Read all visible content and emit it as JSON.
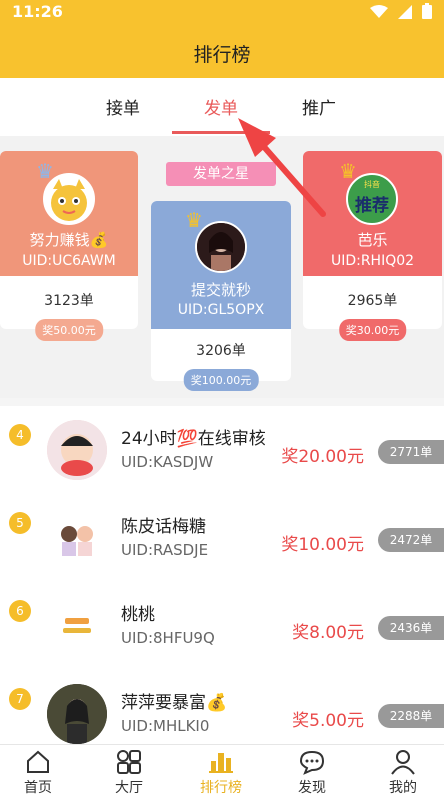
{
  "status": {
    "time": "11:26"
  },
  "header": {
    "title": "排行榜"
  },
  "tabs": [
    {
      "label": "接单"
    },
    {
      "label": "发单"
    },
    {
      "label": "推广"
    }
  ],
  "podium": {
    "banner": "发单之星",
    "second": {
      "name": "努力赚钱💰",
      "uid": "UID:UC6AWM",
      "count": "3123单",
      "prize": "奖50.00元"
    },
    "first": {
      "name": "提交就秒",
      "uid": "UID:GL5OPX",
      "count": "3206单",
      "prize": "奖100.00元"
    },
    "third": {
      "name": "芭乐",
      "uid": "UID:RHIQ02",
      "count": "2965单",
      "prize": "奖30.00元",
      "avatar_text": "推荐",
      "avatar_sub": "抖音"
    }
  },
  "list": [
    {
      "rank": "4",
      "name": "24小时💯在线审核",
      "uid": "UID:KASDJW",
      "prize": "奖20.00元",
      "count": "2771单"
    },
    {
      "rank": "5",
      "name": "陈皮话梅糖",
      "uid": "UID:RASDJE",
      "prize": "奖10.00元",
      "count": "2472单"
    },
    {
      "rank": "6",
      "name": "桃桃",
      "uid": "UID:8HFU9Q",
      "prize": "奖8.00元",
      "count": "2436单"
    },
    {
      "rank": "7",
      "name": "萍萍要暴富💰",
      "uid": "UID:MHLKI0",
      "prize": "奖5.00元",
      "count": "2288单"
    }
  ],
  "nav": [
    {
      "label": "首页",
      "icon": "home-icon"
    },
    {
      "label": "大厅",
      "icon": "grid-icon"
    },
    {
      "label": "排行榜",
      "icon": "ranking-icon"
    },
    {
      "label": "发现",
      "icon": "chat-icon"
    },
    {
      "label": "我的",
      "icon": "profile-icon"
    }
  ],
  "colors": {
    "brand_yellow": "#f8c22e",
    "accent_red": "#e95a5a",
    "second_card": "#f0967a",
    "first_card": "#8ba9d8",
    "third_card": "#f06a6a"
  }
}
